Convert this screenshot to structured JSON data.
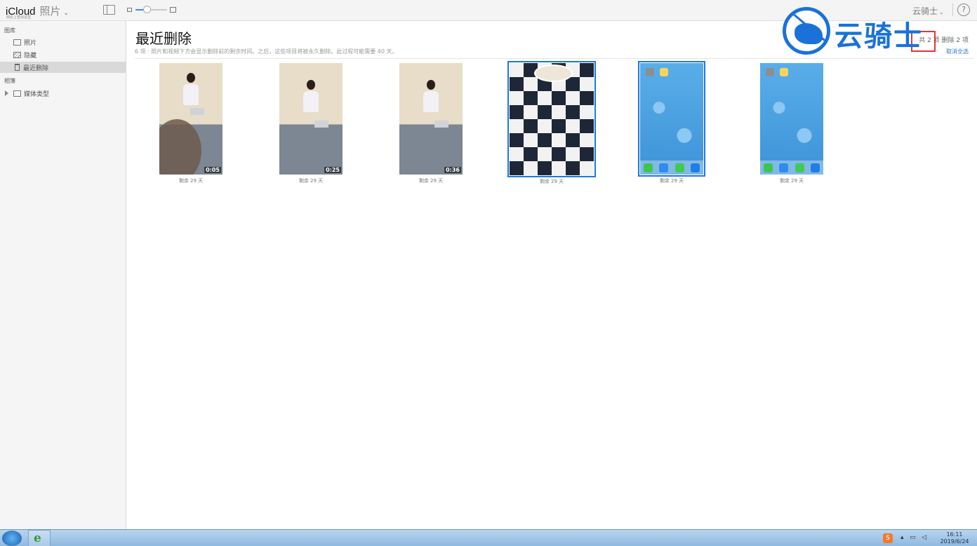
{
  "header": {
    "icloud": "iCloud",
    "app_name": "照片",
    "app_sub": "网云上查找这里",
    "user": "云骑士",
    "help": "?"
  },
  "zoom": {
    "level": 0.35
  },
  "sidebar": {
    "library_label": "图库",
    "albums_label": "相簿",
    "items": [
      {
        "label": "照片"
      },
      {
        "label": "隐藏"
      },
      {
        "label": "最近删除"
      }
    ],
    "media_types": "媒体类型"
  },
  "main": {
    "title": "最近删除",
    "subtitle": "6 项 · 照片和视频下方会显示删除前的剩余时间。之后，这些项目将被永久删除。此过程可能需要 40 天。",
    "selection": "共 2 项  删除 2 项",
    "deselect": "取消全选"
  },
  "watermark": {
    "text": "云骑士"
  },
  "thumbnails": [
    {
      "caption": "剩余 29 天",
      "duration": "0:05"
    },
    {
      "caption": "剩余 29 天",
      "duration": "0:25"
    },
    {
      "caption": "剩余 29 天",
      "duration": "0:36"
    },
    {
      "caption": "剩余 29 天"
    },
    {
      "caption": "剩余 29 天"
    },
    {
      "caption": "剩余 29 天"
    }
  ],
  "taskbar": {
    "ie": "e",
    "ime": "S",
    "time": "16:11",
    "date": "2019/6/24"
  },
  "colors": {
    "accent": "#1e78e0",
    "highlight_box": "#e0383a",
    "watermark": "#1a72d8"
  }
}
